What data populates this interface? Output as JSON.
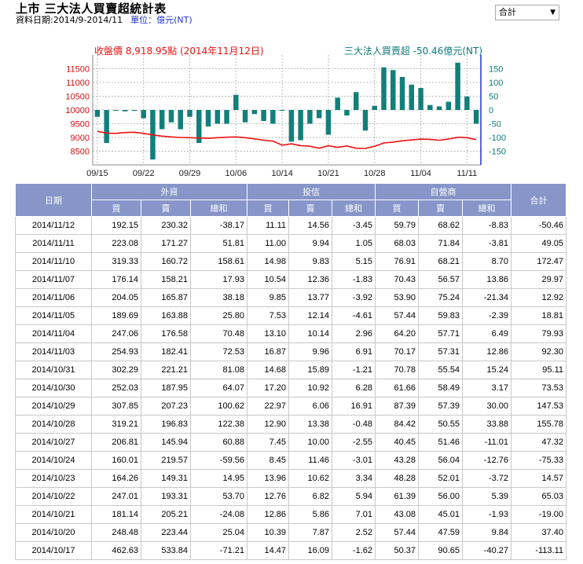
{
  "header": {
    "title": "上市 三大法人買賣超統計表",
    "date_range": "資料日期:2014/9-2014/11",
    "unit": "單位：億元(NT)"
  },
  "selector": {
    "value": "合計"
  },
  "chart_legend": {
    "close_label": "收盤價 8,918.95點 (2014年11月12日)",
    "net_label": "三大法人買賣超 -50.46億元(NT)"
  },
  "colors": {
    "close_line": "#ee1111",
    "net_bar": "#137f7a",
    "header_bg": "#8795c8",
    "left_axis": "#cc1111",
    "right_axis": "#117a7a",
    "right_axis_line": "#2233cc"
  },
  "chart_data": {
    "type": "bar+line",
    "left_ylim": [
      8000,
      12000
    ],
    "left_yticks": [
      8500,
      9000,
      9500,
      10000,
      10500,
      11000,
      11500
    ],
    "right_ylim": [
      -200,
      200
    ],
    "right_yticks": [
      150,
      100,
      50,
      0,
      -50,
      -100,
      -150
    ],
    "xticks": [
      "09/15",
      "09/22",
      "09/29",
      "10/06",
      "10/14",
      "10/21",
      "10/28",
      "11/04",
      "11/11"
    ],
    "xtick_index": [
      0,
      5,
      10,
      15,
      20,
      25,
      30,
      35,
      40
    ],
    "grid": true,
    "dates": [
      "09/15",
      "09/16",
      "09/17",
      "09/18",
      "09/19",
      "09/22",
      "09/23",
      "09/24",
      "09/25",
      "09/26",
      "09/29",
      "09/30",
      "10/01",
      "10/02",
      "10/03",
      "10/06",
      "10/07",
      "10/08",
      "10/09",
      "10/13",
      "10/14",
      "10/15",
      "10/16",
      "10/17",
      "10/20",
      "10/21",
      "10/22",
      "10/23",
      "10/24",
      "10/27",
      "10/28",
      "10/29",
      "10/30",
      "10/31",
      "11/03",
      "11/04",
      "11/05",
      "11/06",
      "11/07",
      "11/10",
      "11/11",
      "11/12"
    ],
    "series": [
      {
        "name": "三大法人買賣超",
        "type": "bar",
        "values": [
          -25,
          -120,
          -2,
          -5,
          -2,
          -30,
          -180,
          -70,
          -45,
          -70,
          -25,
          -120,
          -60,
          -50,
          -50,
          55,
          -45,
          -15,
          -40,
          -50,
          -3,
          -115,
          -110,
          -50,
          -30,
          -90,
          45,
          -20,
          65,
          -75,
          15,
          155,
          145,
          120,
          92,
          80,
          18,
          13,
          30,
          172,
          49,
          -50
        ]
      },
      {
        "name": "收盤價",
        "type": "line",
        "values": [
          9220,
          9160,
          9150,
          9180,
          9190,
          9150,
          9090,
          9050,
          9020,
          9000,
          8990,
          8980,
          8970,
          8990,
          9010,
          9020,
          8990,
          8950,
          8900,
          8870,
          8720,
          8770,
          8700,
          8680,
          8610,
          8700,
          8640,
          8690,
          8610,
          8600,
          8680,
          8800,
          8830,
          8880,
          8910,
          8940,
          8930,
          8900,
          8940,
          9010,
          8990,
          8919
        ]
      }
    ]
  },
  "table": {
    "headers_top": [
      "日期",
      "外資",
      "投信",
      "自營商",
      "合計"
    ],
    "headers_sub": [
      "買",
      "賣",
      "總和",
      "買",
      "賣",
      "總和",
      "買",
      "賣",
      "總和"
    ],
    "rows": [
      [
        "2014/11/12",
        "192.15",
        "230.32",
        "-38.17",
        "11.11",
        "14.56",
        "-3.45",
        "59.79",
        "68.62",
        "-8.83",
        "-50.46"
      ],
      [
        "2014/11/11",
        "223.08",
        "171.27",
        "51.81",
        "11.00",
        "9.94",
        "1.05",
        "68.03",
        "71.84",
        "-3.81",
        "49.05"
      ],
      [
        "2014/11/10",
        "319.33",
        "160.72",
        "158.61",
        "14.98",
        "9.83",
        "5.15",
        "76.91",
        "68.21",
        "8.70",
        "172.47"
      ],
      [
        "2014/11/07",
        "176.14",
        "158.21",
        "17.93",
        "10.54",
        "12.36",
        "-1.83",
        "70.43",
        "56.57",
        "13.86",
        "29.97"
      ],
      [
        "2014/11/06",
        "204.05",
        "165.87",
        "38.18",
        "9.85",
        "13.77",
        "-3.92",
        "53.90",
        "75.24",
        "-21.34",
        "12.92"
      ],
      [
        "2014/11/05",
        "189.69",
        "163.88",
        "25.80",
        "7.53",
        "12.14",
        "-4.61",
        "57.44",
        "59.83",
        "-2.39",
        "18.81"
      ],
      [
        "2014/11/04",
        "247.06",
        "176.58",
        "70.48",
        "13.10",
        "10.14",
        "2.96",
        "64.20",
        "57.71",
        "6.49",
        "79.93"
      ],
      [
        "2014/11/03",
        "254.93",
        "182.41",
        "72.53",
        "16.87",
        "9.96",
        "6.91",
        "70.17",
        "57.31",
        "12.86",
        "92.30"
      ],
      [
        "2014/10/31",
        "302.29",
        "221.21",
        "81.08",
        "14.68",
        "15.89",
        "-1.21",
        "70.78",
        "55.54",
        "15.24",
        "95.11"
      ],
      [
        "2014/10/30",
        "252.03",
        "187.95",
        "64.07",
        "17.20",
        "10.92",
        "6.28",
        "61.66",
        "58.49",
        "3.17",
        "73.53"
      ],
      [
        "2014/10/29",
        "307.85",
        "207.23",
        "100.62",
        "22.97",
        "6.06",
        "16.91",
        "87.39",
        "57.39",
        "30.00",
        "147.53"
      ],
      [
        "2014/10/28",
        "319.21",
        "196.83",
        "122.38",
        "12.90",
        "13.38",
        "-0.48",
        "84.42",
        "50.55",
        "33.88",
        "155.78"
      ],
      [
        "2014/10/27",
        "206.81",
        "145.94",
        "60.88",
        "7.45",
        "10.00",
        "-2.55",
        "40.45",
        "51.46",
        "-11.01",
        "47.32"
      ],
      [
        "2014/10/24",
        "160.01",
        "219.57",
        "-59.56",
        "8.45",
        "11.46",
        "-3.01",
        "43.28",
        "56.04",
        "-12.76",
        "-75.33"
      ],
      [
        "2014/10/23",
        "164.26",
        "149.31",
        "14.95",
        "13.96",
        "10.62",
        "3.34",
        "48.28",
        "52.01",
        "-3.72",
        "14.57"
      ],
      [
        "2014/10/22",
        "247.01",
        "193.31",
        "53.70",
        "12.76",
        "6.82",
        "5.94",
        "61.39",
        "56.00",
        "5.39",
        "65.03"
      ],
      [
        "2014/10/21",
        "181.14",
        "205.21",
        "-24.08",
        "12.86",
        "5.86",
        "7.01",
        "43.08",
        "45.01",
        "-1.93",
        "-19.00"
      ],
      [
        "2014/10/20",
        "248.48",
        "223.44",
        "25.04",
        "10.39",
        "7.87",
        "2.52",
        "57.44",
        "47.59",
        "9.84",
        "37.40"
      ],
      [
        "2014/10/17",
        "462.63",
        "533.84",
        "-71.21",
        "14.47",
        "16.09",
        "-1.62",
        "50.37",
        "90.65",
        "-40.27",
        "-113.11"
      ]
    ]
  }
}
